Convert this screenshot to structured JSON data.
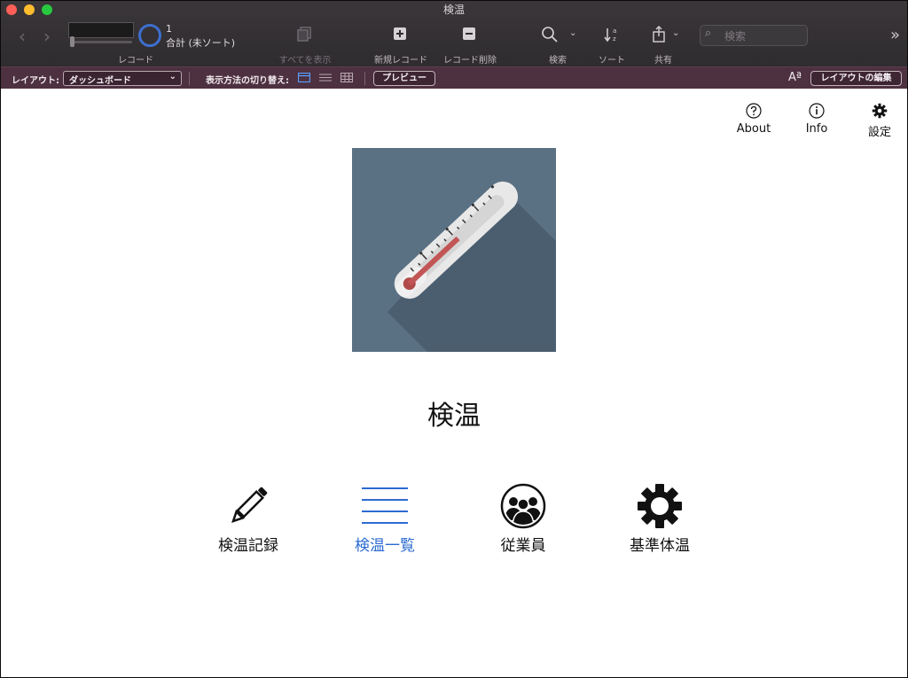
{
  "window": {
    "title": "検温"
  },
  "toolbar": {
    "record_count": "1",
    "record_total": "合計 (未ソート)",
    "records_label": "レコード",
    "show_all_label": "すべてを表示",
    "new_record_label": "新規レコード",
    "delete_record_label": "レコード削除",
    "search_label": "検索",
    "sort_label": "ソート",
    "share_label": "共有",
    "search_placeholder": "検索"
  },
  "layout_bar": {
    "layout_label": "レイアウト:",
    "layout_value": "ダッシュボード",
    "view_switch_label": "表示方法の切り替え:",
    "preview_button": "プレビュー",
    "font_glyph": "Aª",
    "edit_layout_button": "レイアウトの編集"
  },
  "top_actions": [
    {
      "label": "About",
      "icon": "question-circle-icon"
    },
    {
      "label": "Info",
      "icon": "info-circle-icon"
    },
    {
      "label": "設定",
      "icon": "gear-icon"
    }
  ],
  "main": {
    "app_title": "検温",
    "hero_icon": "thermometer-icon"
  },
  "nav": [
    {
      "label": "検温記録",
      "icon": "pencil-icon",
      "active": false
    },
    {
      "label": "検温一覧",
      "icon": "list-icon",
      "active": true
    },
    {
      "label": "従業員",
      "icon": "people-icon",
      "active": false
    },
    {
      "label": "基準体温",
      "icon": "gear-icon",
      "active": false
    }
  ],
  "colors": {
    "titlebar": "#332f32",
    "layoutbar": "#4d3140",
    "accent": "#2d6bd1",
    "hero_bg": "#5a7083"
  }
}
